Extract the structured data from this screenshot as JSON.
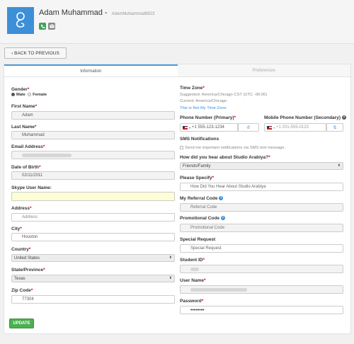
{
  "header": {
    "name": "Adam Muhammad",
    "separator": " - ",
    "user_id": "AdamMuhammad8923"
  },
  "back_button": "‹ BACK TO PREVIOUS",
  "tabs": [
    {
      "label": "Information",
      "active": true
    },
    {
      "label": "Preferences",
      "active": false
    }
  ],
  "left": {
    "gender": {
      "label": "Gender",
      "options": [
        "Male",
        "Female"
      ],
      "selected": "Male"
    },
    "first_name": {
      "label": "First Name",
      "value": "Adam"
    },
    "last_name": {
      "label": "Last Name",
      "value": "Muhammad"
    },
    "email": {
      "label": "Email Address"
    },
    "dob": {
      "label": "Date of Birth",
      "value": "02/11/2011"
    },
    "skype": {
      "label": "Skype User Name:",
      "value": ""
    },
    "address": {
      "label": "Address",
      "placeholder": "Address"
    },
    "city": {
      "label": "City",
      "value": "Houston"
    },
    "country": {
      "label": "Country",
      "value": "United States"
    },
    "state": {
      "label": "State/Province",
      "value": "Texas"
    },
    "zip": {
      "label": "Zip Code",
      "value": "77304"
    }
  },
  "right": {
    "timezone": {
      "label": "Time Zone",
      "suggested": "Suggested: America/Chicago CST (UTC -06:00)",
      "current": "Current: America/Chicago",
      "link": "This is Not My Time Zone"
    },
    "phone_primary": {
      "label": "Phone Number (Primary)",
      "placeholder": "+1 555-123-1234"
    },
    "phone_mobile": {
      "label": "Mobile Phone Number (Secondary)",
      "placeholder": "+1 201-555-0123"
    },
    "sms": {
      "label": "SMS Notifications",
      "checkbox": "Send me important notifications via SMS text message."
    },
    "heard": {
      "label": "How did you hear about Studio Arabiya?",
      "value": "Friends/Family"
    },
    "specify": {
      "label": "Please Specify",
      "placeholder": "How Did You Hear About Studio Arabiya"
    },
    "referral": {
      "label": "My Referral Code",
      "placeholder": "Referral Code"
    },
    "promo": {
      "label": "Promotional Code",
      "placeholder": "Promotional Code"
    },
    "special": {
      "label": "Special Request",
      "placeholder": "Special Request"
    },
    "student_id": {
      "label": "Student ID"
    },
    "username": {
      "label": "User Name"
    },
    "password": {
      "label": "Password",
      "value": "••••••••"
    }
  },
  "update_button": "UPDATE",
  "colors": {
    "avatar": "#3d8fd8",
    "accent": "#3b8fd8",
    "update": "#4caf50",
    "required": "#dd0000"
  }
}
